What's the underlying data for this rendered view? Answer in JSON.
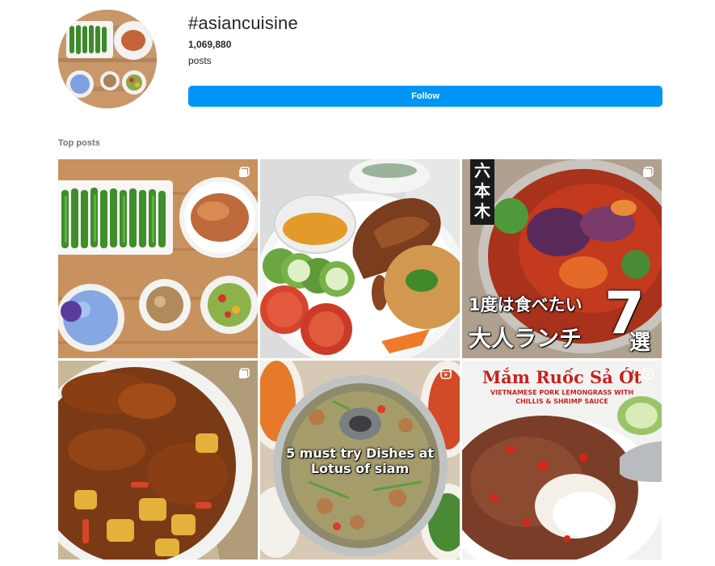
{
  "hashtag": {
    "title": "#asiancuisine",
    "post_count": "1,069,880",
    "post_count_label": "posts",
    "follow_label": "Follow"
  },
  "top_posts": {
    "label": "Top posts",
    "tiles": [
      {
        "name": "greens-pork-chop-spread",
        "badge": "carousel-icon"
      },
      {
        "name": "grilled-chicken-rice-plate",
        "badge": ""
      },
      {
        "name": "roppongi-lunch-reel",
        "badge": "carousel-icon",
        "vertical_text": "六本木",
        "line1": "1度は食べたい",
        "line2": "大人ランチ",
        "big_number": "7",
        "suffix": "選"
      },
      {
        "name": "roast-chicken-drumsticks-potatoes",
        "badge": "carousel-icon"
      },
      {
        "name": "lotus-of-siam-soup",
        "badge": "reel-icon",
        "caption_line1": "5 must try Dishes at",
        "caption_line2": "Lotus of siam"
      },
      {
        "name": "mam-ruoc-sa-ot",
        "badge": "reel-icon",
        "title": "Mắm Ruốc Sả Ớt",
        "subtitle_line1": "VIETNAMESE PORK LEMONGRASS WITH",
        "subtitle_line2": "CHILLIS & SHRIMP SAUCE"
      }
    ]
  }
}
